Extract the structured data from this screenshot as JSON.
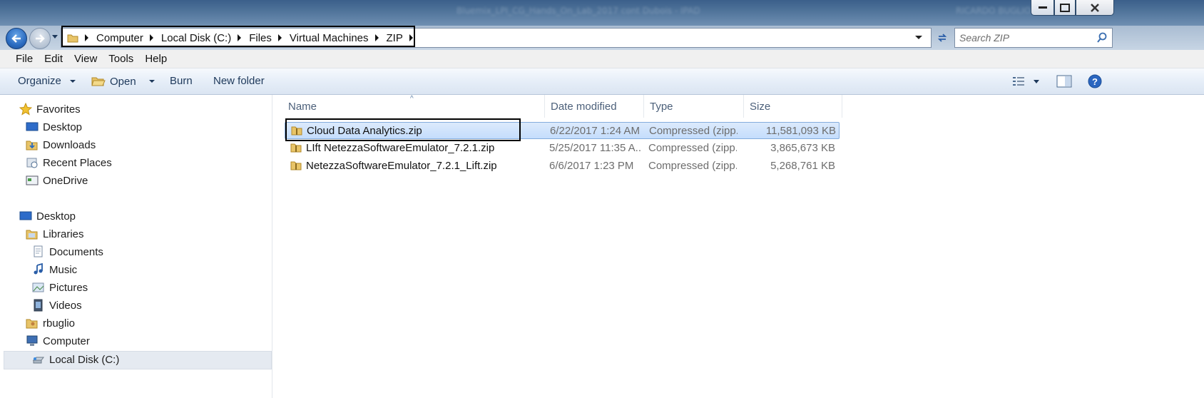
{
  "window": {
    "title_blurred": "Bluemix_LPI_CG_Hands_On_Lab_2017 cont Dubois - IPAD",
    "user_blurred": "RICARDO BUGLIO"
  },
  "nav": {
    "breadcrumbs": [
      "Computer",
      "Local Disk (C:)",
      "Files",
      "Virtual Machines",
      "ZIP"
    ],
    "search_placeholder": "Search ZIP"
  },
  "menu": [
    "File",
    "Edit",
    "View",
    "Tools",
    "Help"
  ],
  "commands": {
    "organize": "Organize",
    "open": "Open",
    "burn": "Burn",
    "new_folder": "New folder"
  },
  "navpane": {
    "favorites": "Favorites",
    "favorites_items": [
      "Desktop",
      "Downloads",
      "Recent Places",
      "OneDrive"
    ],
    "desktop": "Desktop",
    "libraries": "Libraries",
    "libraries_items": [
      "Documents",
      "Music",
      "Pictures",
      "Videos"
    ],
    "user": "rbuglio",
    "computer": "Computer",
    "local_disk": "Local Disk (C:)"
  },
  "columns": {
    "name": "Name",
    "date": "Date modified",
    "type": "Type",
    "size": "Size"
  },
  "files": [
    {
      "name": "Cloud Data Analytics.zip",
      "date": "6/22/2017 1:24 AM",
      "type": "Compressed (zipp...",
      "size": "11,581,093 KB",
      "selected": true
    },
    {
      "name": "LIft NetezzaSoftwareEmulator_7.2.1.zip",
      "date": "5/25/2017 11:35 A...",
      "type": "Compressed (zipp...",
      "size": "3,865,673 KB",
      "selected": false
    },
    {
      "name": "NetezzaSoftwareEmulator_7.2.1_Lift.zip",
      "date": "6/6/2017 1:23 PM",
      "type": "Compressed (zipp...",
      "size": "5,268,761 KB",
      "selected": false
    }
  ],
  "colors": {
    "accent": "#2a6bc0",
    "selection": "#c4ddfc",
    "titlebar": "#4e7299"
  }
}
